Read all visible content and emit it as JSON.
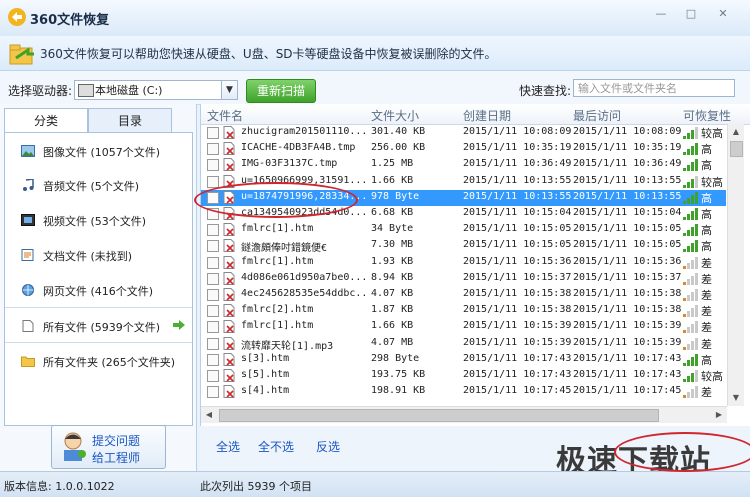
{
  "window": {
    "title": "360文件恢复"
  },
  "banner": {
    "text": "360文件恢复可以帮助您快速从硬盘、U盘、SD卡等硬盘设备中恢复被误删除的文件。"
  },
  "toolbar": {
    "drive_label": "选择驱动器:",
    "drive_value": "本地磁盘 (C:)",
    "scan_label": "重新扫描",
    "search_label": "快速查找:",
    "search_placeholder": "输入文件或文件夹名"
  },
  "tabs": [
    "分类",
    "目录"
  ],
  "categories": [
    {
      "label": "图像文件 (1057个文件)",
      "icon": "image-icon"
    },
    {
      "label": "音频文件 (5个文件)",
      "icon": "music-icon"
    },
    {
      "label": "视频文件 (53个文件)",
      "icon": "video-icon"
    },
    {
      "label": "文档文件 (未找到)",
      "icon": "document-icon"
    },
    {
      "label": "网页文件 (416个文件)",
      "icon": "globe-icon"
    },
    {
      "label": "所有文件 (5939个文件)",
      "icon": "file-icon"
    },
    {
      "label": "所有文件夹 (265个文件夹)",
      "icon": "folder-icon"
    }
  ],
  "support": {
    "line1": "提交问题",
    "line2": "给工程师"
  },
  "table": {
    "headers": [
      "文件名",
      "文件大小",
      "创建日期",
      "最后访问",
      "可恢复性"
    ],
    "rows": [
      {
        "name": "zhucigram201501110...",
        "size": "301.40 KB",
        "created": "2015/1/11 10:08:09",
        "accessed": "2015/1/11 10:08:09",
        "recover": "较高"
      },
      {
        "name": "ICACHE-4DB3FA4B.tmp",
        "size": "256.00 KB",
        "created": "2015/1/11 10:35:19",
        "accessed": "2015/1/11 10:35:19",
        "recover": "高"
      },
      {
        "name": "IMG-03F3137C.tmp",
        "size": "1.25 MB",
        "created": "2015/1/11 10:36:49",
        "accessed": "2015/1/11 10:36:49",
        "recover": "高"
      },
      {
        "name": "u=1650966999,31591...",
        "size": "1.66 KB",
        "created": "2015/1/11 10:13:55",
        "accessed": "2015/1/11 10:13:55",
        "recover": "较高"
      },
      {
        "name": "u=1874791996,28334...",
        "size": "978 Byte",
        "created": "2015/1/11 10:13:55",
        "accessed": "2015/1/11 10:13:55",
        "recover": "高"
      },
      {
        "name": "ca1349540923dd54d0...",
        "size": "6.68 KB",
        "created": "2015/1/11 10:15:04",
        "accessed": "2015/1/11 10:15:04",
        "recover": "高"
      },
      {
        "name": "fmlrc[1].htm",
        "size": "34 Byte",
        "created": "2015/1/11 10:15:05",
        "accessed": "2015/1/11 10:15:05",
        "recover": "高"
      },
      {
        "name": "鐩澹頗俸吋錯鏡便€",
        "size": "7.30 MB",
        "created": "2015/1/11 10:15:05",
        "accessed": "2015/1/11 10:15:05",
        "recover": "高"
      },
      {
        "name": "fmlrc[1].htm",
        "size": "1.93 KB",
        "created": "2015/1/11 10:15:36",
        "accessed": "2015/1/11 10:15:36",
        "recover": "差"
      },
      {
        "name": "4d086e061d950a7be0...",
        "size": "8.94 KB",
        "created": "2015/1/11 10:15:37",
        "accessed": "2015/1/11 10:15:37",
        "recover": "差"
      },
      {
        "name": "4ec245628535e54ddbc...",
        "size": "4.07 KB",
        "created": "2015/1/11 10:15:38",
        "accessed": "2015/1/11 10:15:38",
        "recover": "差"
      },
      {
        "name": "fmlrc[2].htm",
        "size": "1.87 KB",
        "created": "2015/1/11 10:15:38",
        "accessed": "2015/1/11 10:15:38",
        "recover": "差"
      },
      {
        "name": "fmlrc[1].htm",
        "size": "1.66 KB",
        "created": "2015/1/11 10:15:39",
        "accessed": "2015/1/11 10:15:39",
        "recover": "差"
      },
      {
        "name": "流转靡天轮[1].mp3",
        "size": "4.07 MB",
        "created": "2015/1/11 10:15:39",
        "accessed": "2015/1/11 10:15:39",
        "recover": "差"
      },
      {
        "name": "s[3].htm",
        "size": "298 Byte",
        "created": "2015/1/11 10:17:43",
        "accessed": "2015/1/11 10:17:43",
        "recover": "高"
      },
      {
        "name": "s[5].htm",
        "size": "193.75 KB",
        "created": "2015/1/11 10:17:43",
        "accessed": "2015/1/11 10:17:43",
        "recover": "较高"
      },
      {
        "name": "s[4].htm",
        "size": "198.91 KB",
        "created": "2015/1/11 10:17:45",
        "accessed": "2015/1/11 10:17:45",
        "recover": "差"
      }
    ]
  },
  "actions": {
    "select_all": "全选",
    "select_none": "全不选",
    "invert": "反选"
  },
  "watermark": "极速下载站",
  "status": {
    "version": "版本信息: 1.0.0.1022",
    "count": "此次列出 5939 个项目"
  },
  "colors": {
    "accent": "#3399ff",
    "scan_green": "#3fa22b",
    "annotation_red": "#d0262d"
  }
}
